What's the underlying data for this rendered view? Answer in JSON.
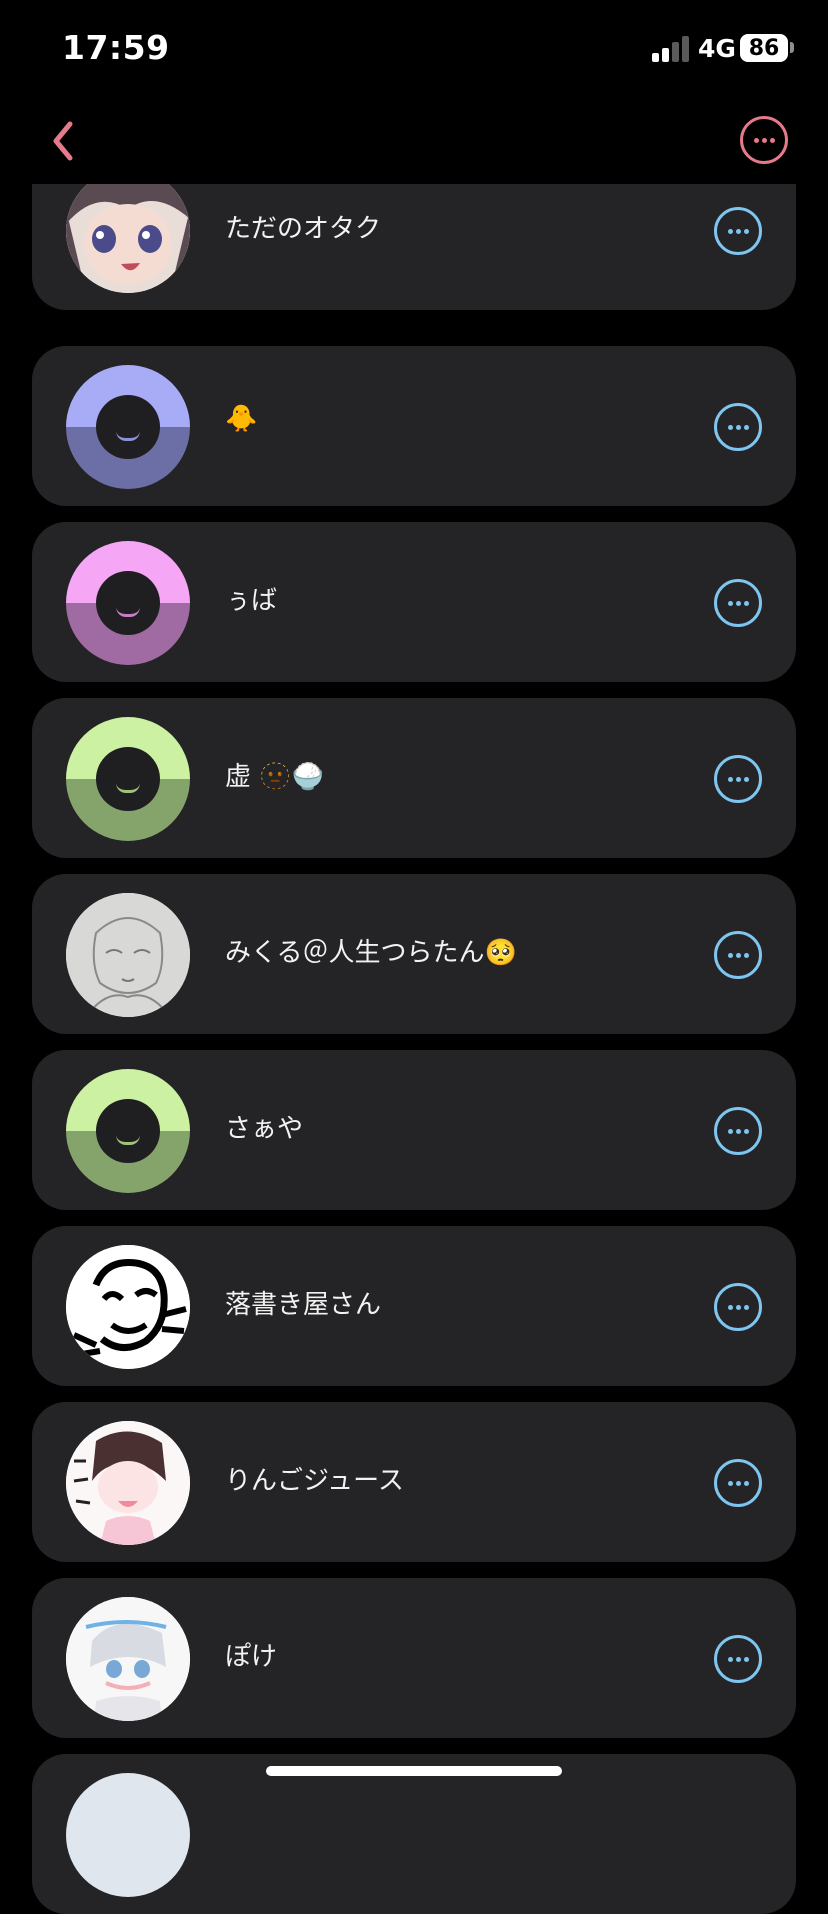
{
  "status_bar": {
    "time": "17:59",
    "network": "4G",
    "battery": "86"
  },
  "nav": {
    "back_icon": "chevron-left-icon",
    "menu_icon": "ellipsis-circle-icon",
    "accent_color": "#e47a8a"
  },
  "list": {
    "more_icon": "ellipsis-circle-icon",
    "more_color": "#7ec6f0",
    "items": [
      {
        "name": "ただのオタク",
        "avatar": "anime-character-photo"
      },
      {
        "name": "🐥",
        "avatar": "default-blue"
      },
      {
        "name": "ぅば",
        "avatar": "default-pink"
      },
      {
        "name": "虚 🫥🍚",
        "avatar": "default-green"
      },
      {
        "name": "みくる＠人生つらたん🥺",
        "avatar": "pencil-sketch-photo"
      },
      {
        "name": "さぁや",
        "avatar": "default-green"
      },
      {
        "name": "落書き屋さん",
        "avatar": "line-drawing-face-photo"
      },
      {
        "name": "りんごジュース",
        "avatar": "anime-drawing-photo"
      },
      {
        "name": "ぽけ",
        "avatar": "anime-drawing-photo"
      }
    ]
  }
}
